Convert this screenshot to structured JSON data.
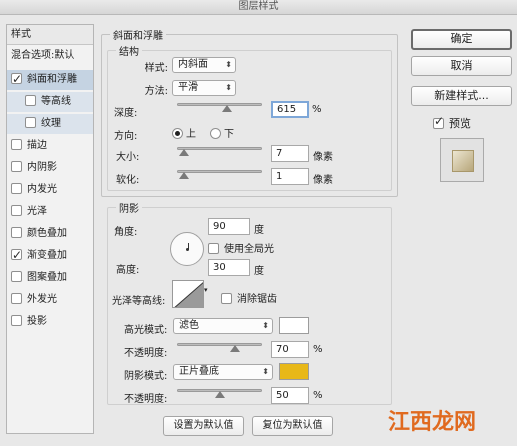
{
  "window": {
    "title": "图层样式"
  },
  "sidebar": {
    "header": "样式",
    "blend_options": "混合选项:默认",
    "items": [
      {
        "label": "斜面和浮雕",
        "checked": true,
        "selected": true
      },
      {
        "label": "等高线",
        "checked": false,
        "sub": true
      },
      {
        "label": "纹理",
        "checked": false,
        "sub": true
      },
      {
        "label": "描边",
        "checked": false
      },
      {
        "label": "内阴影",
        "checked": false
      },
      {
        "label": "内发光",
        "checked": false
      },
      {
        "label": "光泽",
        "checked": false
      },
      {
        "label": "颜色叠加",
        "checked": false
      },
      {
        "label": "渐变叠加",
        "checked": true
      },
      {
        "label": "图案叠加",
        "checked": false
      },
      {
        "label": "外发光",
        "checked": false
      },
      {
        "label": "投影",
        "checked": false
      }
    ]
  },
  "bevel": {
    "group_title": "斜面和浮雕",
    "structure_title": "结构",
    "style_label": "样式:",
    "style_value": "内斜面",
    "technique_label": "方法:",
    "technique_value": "平滑",
    "depth_label": "深度:",
    "depth_value": "615",
    "depth_unit": "%",
    "depth_level": 0.6,
    "direction_label": "方向:",
    "dir_up": "上",
    "dir_down": "下",
    "size_label": "大小:",
    "size_value": "7",
    "size_unit": "像素",
    "size_level": 0.02,
    "soften_label": "软化:",
    "soften_value": "1",
    "soften_unit": "像素",
    "soften_level": 0.02
  },
  "shading": {
    "title": "阴影",
    "angle_label": "角度:",
    "angle_value": "90",
    "angle_unit": "度",
    "global_light": "使用全局光",
    "altitude_label": "高度:",
    "altitude_value": "30",
    "altitude_unit": "度",
    "gloss_label": "光泽等高线:",
    "antialias": "消除锯齿",
    "highlight_label": "高光模式:",
    "highlight_value": "滤色",
    "highlight_opacity_label": "不透明度:",
    "highlight_opacity_value": "70",
    "highlight_opacity_unit": "%",
    "highlight_opacity_level": 0.7,
    "shadow_label": "阴影模式:",
    "shadow_value": "正片叠底",
    "shadow_opacity_label": "不透明度:",
    "shadow_opacity_value": "50",
    "shadow_opacity_unit": "%",
    "shadow_opacity_level": 0.5,
    "highlight_color": "#ffffff",
    "shadow_color": "#e8b818"
  },
  "footer": {
    "make_default": "设置为默认值",
    "reset_default": "复位为默认值"
  },
  "actions": {
    "ok": "确定",
    "cancel": "取消",
    "new_style": "新建样式...",
    "preview": "预览"
  },
  "watermark": "江西龙网"
}
